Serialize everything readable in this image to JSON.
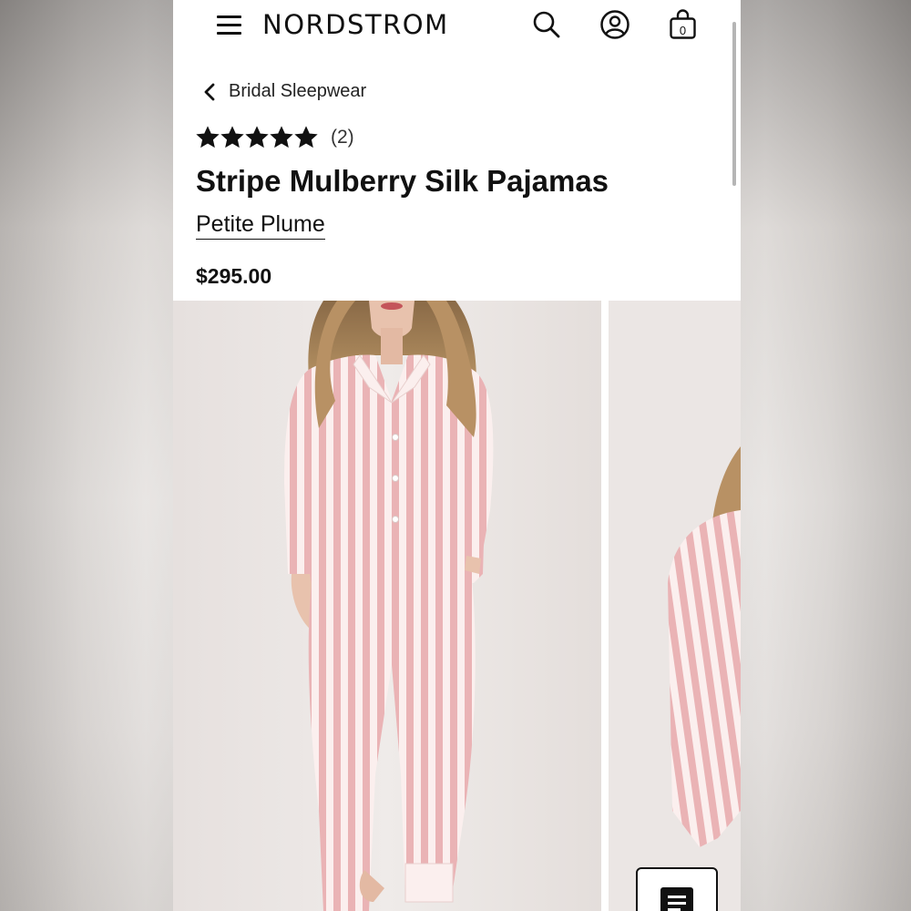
{
  "header": {
    "logo": "NORDSTROM",
    "menu_icon": "hamburger-menu-icon",
    "search_icon": "search-icon",
    "account_icon": "account-icon",
    "bag_icon": "shopping-bag-icon",
    "bag_count": "0"
  },
  "breadcrumb": {
    "icon": "chevron-left-icon",
    "label": "Bridal Sleepwear"
  },
  "product": {
    "rating": 5,
    "rating_max": 5,
    "review_count": "(2)",
    "title": "Stripe Mulberry Silk Pajamas",
    "brand": "Petite Plume",
    "price": "$295.00"
  },
  "gallery": {
    "images": [
      "product-photo-front",
      "product-photo-side"
    ]
  },
  "colors": {
    "text": "#111111",
    "stripe_pink": "#e9aeb0",
    "stripe_light": "#fbefee",
    "photo_background": "#ebe6e4"
  }
}
